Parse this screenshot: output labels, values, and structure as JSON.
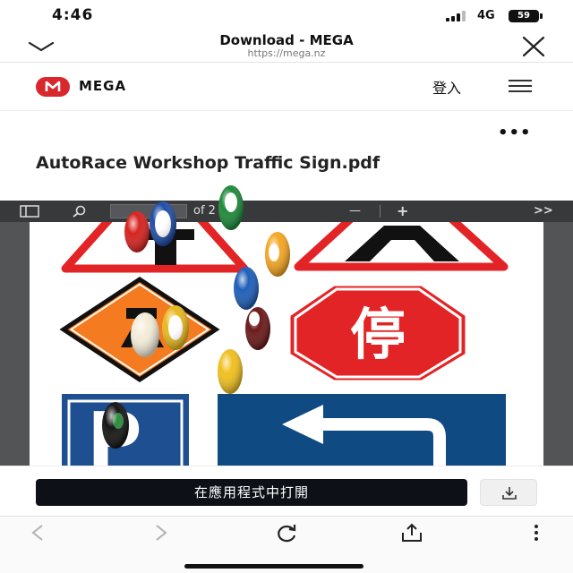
{
  "status": {
    "time": "4:46",
    "network": "4G",
    "battery": "59"
  },
  "browser": {
    "title": "Download - MEGA",
    "url": "https://mega.nz"
  },
  "mega": {
    "brand": "MEGA",
    "login": "登入",
    "brand_color": "#d9272e"
  },
  "file": {
    "more": "•••",
    "title": "AutoRace Workshop Traffic Sign.pdf"
  },
  "pdf_toolbar": {
    "of_label": "of 2",
    "minus": "—",
    "plus": "+",
    "more": ">>"
  },
  "signs": {
    "stop_char": "停",
    "parking_letter": "P"
  },
  "actions": {
    "open_app": "在應用程式中打開"
  },
  "icons": {
    "chevron": "chevron-down-icon",
    "close": "close-icon",
    "menu": "hamburger-menu-icon",
    "sidebar": "sidebar-toggle-icon",
    "search": "search-icon",
    "download": "download-icon",
    "back": "back-arrow-icon",
    "forward": "forward-arrow-icon",
    "reload": "reload-icon",
    "share": "share-icon",
    "kebab": "kebab-menu-icon"
  }
}
